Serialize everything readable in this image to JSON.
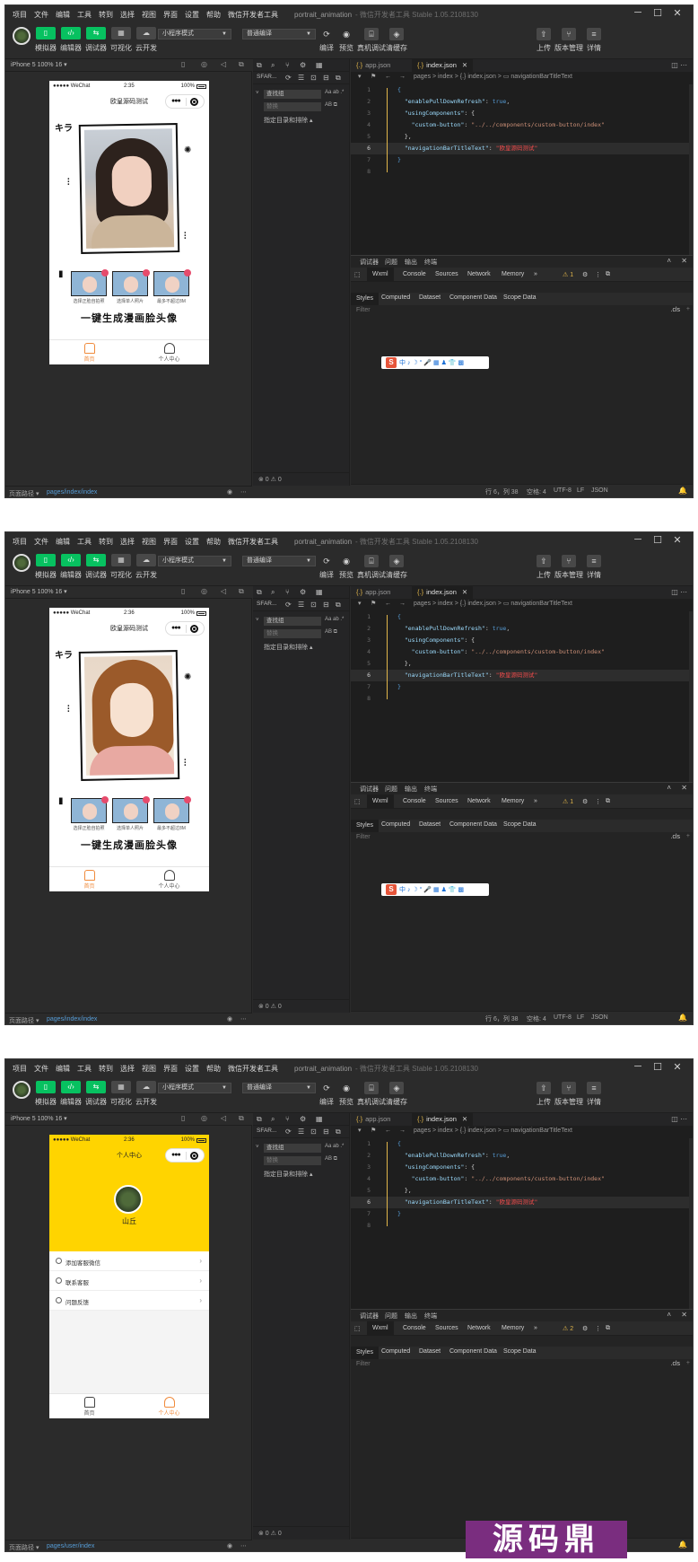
{
  "menu": [
    "项目",
    "文件",
    "编辑",
    "工具",
    "转到",
    "选择",
    "视图",
    "界面",
    "设置",
    "帮助",
    "微信开发者工具"
  ],
  "window": {
    "project": "portrait_animation",
    "suffix": "- 微信开发者工具 Stable 1.05.2108130"
  },
  "toolbar": {
    "labels": [
      "模拟器",
      "编辑器",
      "调试器",
      "可视化",
      "云开发"
    ],
    "mode_select": "小程序模式",
    "compile_select": "普通编译",
    "right_labels": [
      "编译",
      "预览",
      "真机调试",
      "清缓存"
    ],
    "far_right_labels": [
      "上传",
      "版本管理",
      "详情"
    ]
  },
  "simulator": {
    "device": "iPhone 5 100% 16 ▾"
  },
  "phone": {
    "carrier": "●●●●● WeChat",
    "battery": "100%",
    "home": {
      "time1": "2:35",
      "time2": "2:36",
      "nav_title": "欧皇源码测试",
      "slogan": "一键生成漫画脸头像",
      "samples": [
        "选择正脸自拍照",
        "选择单人照片",
        "最多不超过8M"
      ]
    },
    "user": {
      "time": "2:36",
      "nav_title": "个人中心",
      "name": "山丘",
      "rows": [
        "添加客服微信",
        "联系客服",
        "问题反馈"
      ]
    },
    "tabs": {
      "home": "首页",
      "user": "个人中心"
    }
  },
  "sim_status": {
    "label": "页面路径 ▾",
    "path_home": "pages/index/index",
    "path_user": "pages/user/index"
  },
  "explorer": {
    "header": "SFAR...",
    "search_value": "查找组",
    "search_placeholder": "替换",
    "option": "指定目录和排除 ▴",
    "status": "⊗ 0 ⚠ 0"
  },
  "editor": {
    "tabs": [
      {
        "label": "app.json"
      },
      {
        "label": "index.json"
      }
    ],
    "breadcrumb": "pages > index > {.} index.json > ▭ navigationBarTitleText",
    "lines": [
      {
        "n": "1",
        "parts": [
          {
            "c": "b",
            "t": "{"
          }
        ]
      },
      {
        "n": "2",
        "parts": [
          {
            "c": "k",
            "t": "  \"enablePullDownRefresh\""
          },
          {
            "c": "",
            "t": ": "
          },
          {
            "c": "b",
            "t": "true"
          },
          {
            "c": "",
            "t": ","
          }
        ]
      },
      {
        "n": "3",
        "parts": [
          {
            "c": "k",
            "t": "  \"usingComponents\""
          },
          {
            "c": "",
            "t": ": {"
          }
        ]
      },
      {
        "n": "4",
        "parts": [
          {
            "c": "k",
            "t": "    \"custom-button\""
          },
          {
            "c": "",
            "t": ": "
          },
          {
            "c": "s",
            "t": "\"../../components/custom-button/index\""
          }
        ]
      },
      {
        "n": "5",
        "parts": [
          {
            "c": "",
            "t": "  },"
          }
        ]
      },
      {
        "n": "6",
        "parts": [
          {
            "c": "k",
            "t": "  \"navigationBarTitleText\""
          },
          {
            "c": "",
            "t": ": "
          },
          {
            "c": "red",
            "t": "\"欧皇源码测试\""
          }
        ]
      },
      {
        "n": "7",
        "parts": [
          {
            "c": "b",
            "t": "}"
          }
        ]
      },
      {
        "n": "8",
        "parts": []
      }
    ],
    "status": {
      "pos": "行 6，列 38",
      "spaces": "空格: 4",
      "enc": "UTF-8",
      "eol": "LF",
      "lang": "JSON"
    }
  },
  "devtools": {
    "head": [
      "调试器",
      "问题",
      "输出",
      "终端"
    ],
    "tabs": [
      "Wxml",
      "Console",
      "Sources",
      "Network",
      "Memory",
      "»"
    ],
    "warn1": "⚠ 1",
    "warn2": "⚠ 2",
    "sub_tabs": [
      "Styles",
      "Computed",
      "Dataset",
      "Component Data",
      "Scope Data"
    ],
    "filter": "Filter",
    "cls": ".cls",
    "ime": "中 ♪ ☽ ° 🎤 ▦ ♟ 👕 ▩"
  },
  "watermark": "源码鼎"
}
